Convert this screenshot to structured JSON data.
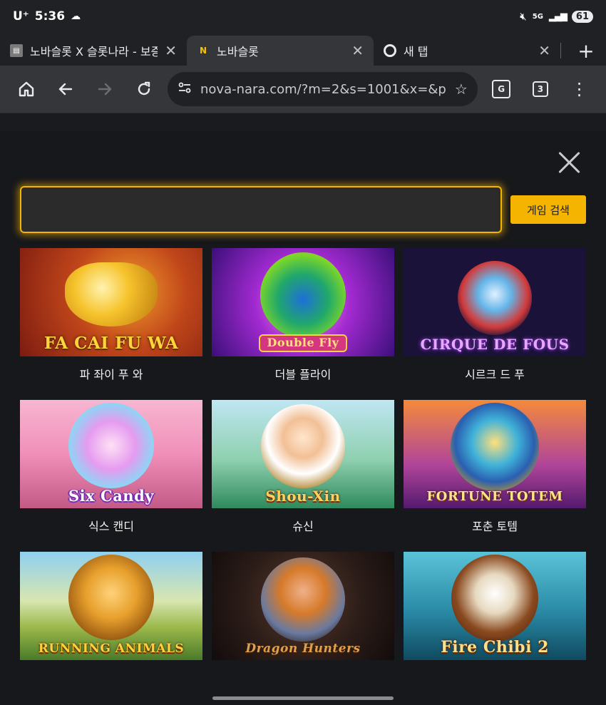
{
  "status_bar": {
    "carrier": "U⁺",
    "time": "5:36",
    "network": "5G",
    "battery": "61"
  },
  "tabs": [
    {
      "favicon": "slot-icon",
      "title": "노바슬롯 X 슬롯나라 - 보증",
      "active": false
    },
    {
      "favicon": "N",
      "title": "노바슬롯",
      "active": true
    },
    {
      "favicon": "chrome-icon",
      "title": "새 탭",
      "active": false
    }
  ],
  "toolbar": {
    "url": "nova-nara.com/?m=2&s=1001&x=&p",
    "tab_count": "3"
  },
  "search": {
    "placeholder": "",
    "value": "",
    "button_label": "게임 검색"
  },
  "games": [
    {
      "name": "파 좌이 푸 와",
      "logo": "FA CAI FU WA"
    },
    {
      "name": "더블 플라이",
      "logo": "Double Fly"
    },
    {
      "name": "시르크 드 푸",
      "logo": "CIRQUE DE FOUS"
    },
    {
      "name": "식스 캔디",
      "logo": "Six Candy"
    },
    {
      "name": "슈신",
      "logo": "Shou-Xin"
    },
    {
      "name": "포춘 토템",
      "logo": "FORTUNE TOTEM"
    },
    {
      "name": "",
      "logo": "RUNNING ANIMALS"
    },
    {
      "name": "",
      "logo": "Dragon Hunters"
    },
    {
      "name": "",
      "logo": "Fire Chibi 2"
    }
  ],
  "colors": {
    "accent": "#f5b400",
    "background": "#17181b",
    "toolbar": "#35363a"
  }
}
